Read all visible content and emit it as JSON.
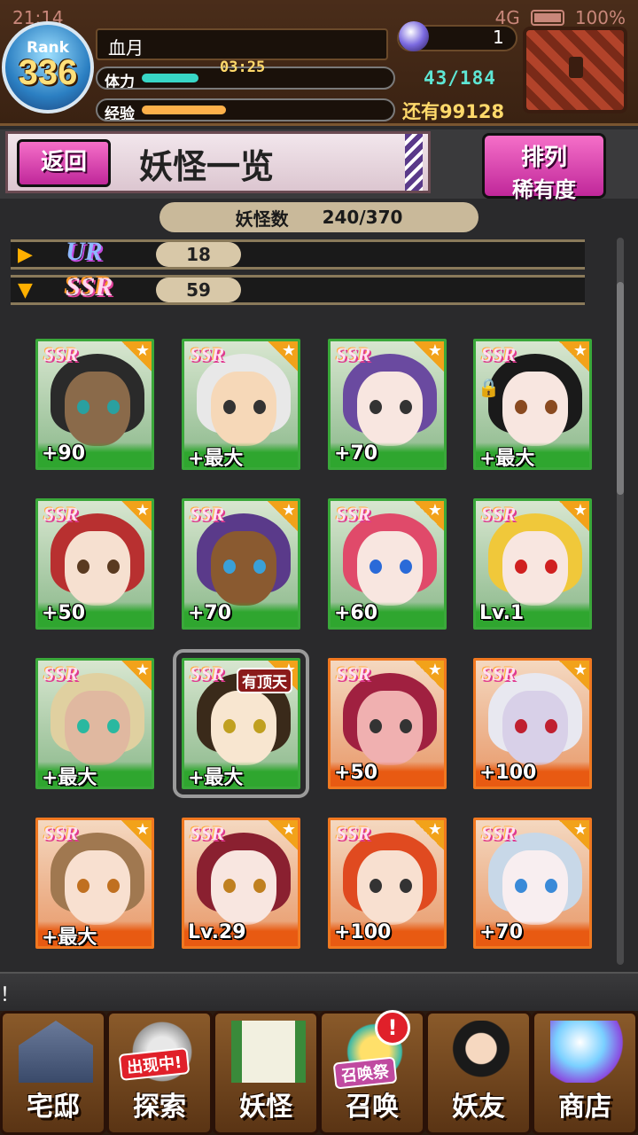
{
  "status_bar": {
    "time": "21:14",
    "battery": "100%",
    "network": "4G"
  },
  "player": {
    "rank_label": "Rank",
    "rank": "336",
    "name": "血月",
    "orb_count": "1",
    "stamina_label": "体力",
    "stamina_timer": "03:25",
    "stamina": "43/184",
    "stamina_fraction": 0.23,
    "exp_label": "经验",
    "exp_remaining": "还有99128",
    "exp_fraction": 0.34
  },
  "titlebar": {
    "back_label": "返回",
    "title": "妖怪一览",
    "sort_label_1": "排列",
    "sort_label_2": "稀有度"
  },
  "count": {
    "label": "妖怪数",
    "value": "240/370"
  },
  "rarity_groups": [
    {
      "name": "UR",
      "count": "18",
      "arrow": "▶"
    },
    {
      "name": "SSR",
      "count": "59",
      "arrow": "▼"
    }
  ],
  "cards": [
    {
      "rarity": "SSR",
      "level": "+90",
      "frame": "green",
      "hair": "#2a2a2a",
      "skin": "#8a6a4a",
      "eye": "#2aa0a0"
    },
    {
      "rarity": "SSR",
      "level": "+最大",
      "frame": "green",
      "hair": "#e8e8e8",
      "skin": "#f6d8b8",
      "eye": "#333"
    },
    {
      "rarity": "SSR",
      "level": "+70",
      "frame": "green",
      "hair": "#6a4aa0",
      "skin": "#f8e6e0",
      "eye": "#333"
    },
    {
      "rarity": "SSR",
      "level": "+最大",
      "frame": "green",
      "hair": "#1a1a1a",
      "skin": "#f8e6e0",
      "eye": "#8a4a20",
      "locked": true
    },
    {
      "rarity": "SSR",
      "level": "+50",
      "frame": "green",
      "hair": "#b83030",
      "skin": "#f6e0d0",
      "eye": "#5a3a20"
    },
    {
      "rarity": "SSR",
      "level": "+70",
      "frame": "green",
      "hair": "#5a3a8a",
      "skin": "#8a5a30",
      "eye": "#3aa0d8"
    },
    {
      "rarity": "SSR",
      "level": "+60",
      "frame": "green",
      "hair": "#e04a6a",
      "skin": "#f8e6e0",
      "eye": "#2a6ad8"
    },
    {
      "rarity": "SSR",
      "level": "Lv.1",
      "frame": "green",
      "hair": "#f0c83a",
      "skin": "#f8e6e0",
      "eye": "#d02020"
    },
    {
      "rarity": "SSR",
      "level": "+最大",
      "frame": "green",
      "hair": "#e0d0a0",
      "skin": "#e0b8a0",
      "eye": "#2ab8a0"
    },
    {
      "rarity": "SSR",
      "level": "+最大",
      "frame": "green",
      "hair": "#3a2a1a",
      "skin": "#f8e6d0",
      "eye": "#c0a020",
      "tag": "有顶天",
      "selected": true
    },
    {
      "rarity": "SSR",
      "level": "+50",
      "frame": "orange",
      "hair": "#a02040",
      "skin": "#f0b0b0",
      "eye": "#333"
    },
    {
      "rarity": "SSR",
      "level": "+100",
      "frame": "orange",
      "hair": "#e8e8f0",
      "skin": "#d8d0e8",
      "eye": "#c02030"
    },
    {
      "rarity": "SSR",
      "level": "+最大",
      "frame": "orange",
      "hair": "#a07850",
      "skin": "#f8e0d0",
      "eye": "#c07020"
    },
    {
      "rarity": "SSR",
      "level": "Lv.29",
      "frame": "orange",
      "hair": "#8a2030",
      "skin": "#f8e6e0",
      "eye": "#c08020"
    },
    {
      "rarity": "SSR",
      "level": "+100",
      "frame": "orange",
      "hair": "#e04a20",
      "skin": "#f8e0d0",
      "eye": "#333"
    },
    {
      "rarity": "SSR",
      "level": "+70",
      "frame": "orange",
      "hair": "#c8d8e8",
      "skin": "#f8eef0",
      "eye": "#3a8ad8"
    }
  ],
  "ticker": "！",
  "nav": [
    {
      "label": "宅邸",
      "icon": "house-icon"
    },
    {
      "label": "探索",
      "icon": "explore-icon",
      "badge": "出现中!"
    },
    {
      "label": "妖怪",
      "icon": "monster-scroll-icon"
    },
    {
      "label": "召唤",
      "icon": "summon-icon",
      "badge": "召唤祭",
      "alert": "!"
    },
    {
      "label": "妖友",
      "icon": "friend-icon"
    },
    {
      "label": "商店",
      "icon": "shop-orb-icon"
    }
  ]
}
